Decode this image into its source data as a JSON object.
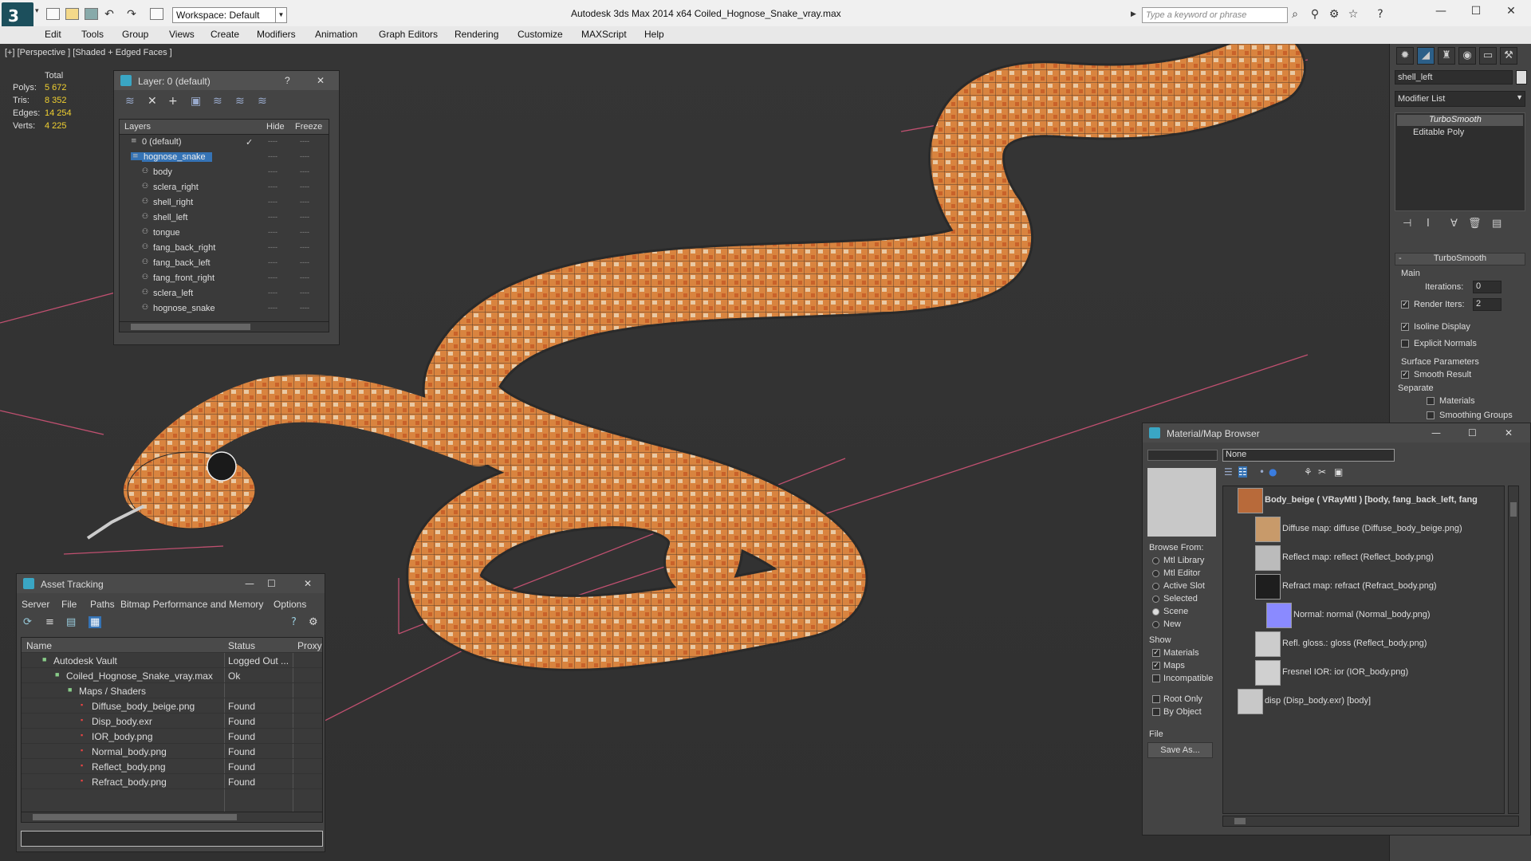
{
  "app": {
    "window_title": "Autodesk 3ds Max  2014 x64      Coiled_Hognose_Snake_vray.max",
    "logo_text": "3",
    "workspace": "Workspace: Default",
    "search_placeholder": "Type a keyword or phrase"
  },
  "menu": [
    "Edit",
    "Tools",
    "Group",
    "Views",
    "Create",
    "Modifiers",
    "Animation",
    "Graph Editors",
    "Rendering",
    "Customize",
    "MAXScript",
    "Help"
  ],
  "viewport": {
    "label": "[+] [Perspective ] [Shaded + Edged Faces ]",
    "stats_title": "Total",
    "stats": [
      {
        "label": "Polys:",
        "value": "5 672"
      },
      {
        "label": "Tris:",
        "value": "8 352"
      },
      {
        "label": "Edges:",
        "value": "14 254"
      },
      {
        "label": "Verts:",
        "value": "4 225"
      }
    ]
  },
  "layer_panel": {
    "title": "Layer: 0 (default)",
    "help": "?",
    "close": "✕",
    "col_layers": "Layers",
    "col_hide": "Hide",
    "col_freeze": "Freeze",
    "rows": [
      {
        "name": "0 (default)",
        "level": 1,
        "selected": false,
        "check": "✓"
      },
      {
        "name": "hognose_snake",
        "level": 1,
        "selected": true,
        "check": ""
      },
      {
        "name": "body",
        "level": 2,
        "selected": false,
        "check": ""
      },
      {
        "name": "sclera_right",
        "level": 2,
        "selected": false,
        "check": ""
      },
      {
        "name": "shell_right",
        "level": 2,
        "selected": false,
        "check": ""
      },
      {
        "name": "shell_left",
        "level": 2,
        "selected": false,
        "check": ""
      },
      {
        "name": "tongue",
        "level": 2,
        "selected": false,
        "check": ""
      },
      {
        "name": "fang_back_right",
        "level": 2,
        "selected": false,
        "check": ""
      },
      {
        "name": "fang_back_left",
        "level": 2,
        "selected": false,
        "check": ""
      },
      {
        "name": "fang_front_right",
        "level": 2,
        "selected": false,
        "check": ""
      },
      {
        "name": "sclera_left",
        "level": 2,
        "selected": false,
        "check": ""
      },
      {
        "name": "hognose_snake",
        "level": 2,
        "selected": false,
        "check": ""
      }
    ]
  },
  "asset_panel": {
    "title": "Asset Tracking",
    "menu": [
      "Server",
      "File",
      "Paths",
      "Bitmap Performance and Memory",
      "Options"
    ],
    "col_name": "Name",
    "col_status": "Status",
    "col_proxy": "Proxy",
    "rows": [
      {
        "name": "Autodesk Vault",
        "status": "Logged Out ...",
        "indent": 1
      },
      {
        "name": "Coiled_Hognose_Snake_vray.max",
        "status": "Ok",
        "indent": 2
      },
      {
        "name": "Maps / Shaders",
        "status": "",
        "indent": 3
      },
      {
        "name": "Diffuse_body_beige.png",
        "status": "Found",
        "indent": 4
      },
      {
        "name": "Disp_body.exr",
        "status": "Found",
        "indent": 4
      },
      {
        "name": "IOR_body.png",
        "status": "Found",
        "indent": 4
      },
      {
        "name": "Normal_body.png",
        "status": "Found",
        "indent": 4
      },
      {
        "name": "Reflect_body.png",
        "status": "Found",
        "indent": 4
      },
      {
        "name": "Refract_body.png",
        "status": "Found",
        "indent": 4
      }
    ]
  },
  "command_panel": {
    "object_name": "shell_left",
    "modifier_list": "Modifier List",
    "stack": [
      "TurboSmooth",
      "Editable Poly"
    ],
    "rollout_title": "TurboSmooth",
    "main_label": "Main",
    "iterations_label": "Iterations:",
    "iterations_value": "0",
    "render_iters_label": "Render Iters:",
    "render_iters_value": "2",
    "isoline": "Isoline Display",
    "explicit_normals": "Explicit Normals",
    "surface_params": "Surface Parameters",
    "smooth_result": "Smooth Result",
    "separate": "Separate",
    "materials": "Materials",
    "smoothing_groups": "Smoothing Groups"
  },
  "material_browser": {
    "title": "Material/Map Browser",
    "search_value": "None",
    "browse_from_label": "Browse From:",
    "browse_from": [
      "Mtl Library",
      "Mtl Editor",
      "Active Slot",
      "Selected",
      "Scene",
      "New"
    ],
    "browse_selected": "Scene",
    "show_label": "Show",
    "show": [
      {
        "label": "Materials",
        "checked": true
      },
      {
        "label": "Maps",
        "checked": true
      },
      {
        "label": "Incompatible",
        "checked": false
      }
    ],
    "root_only": "Root Only",
    "by_object": "By Object",
    "file_label": "File",
    "save_as": "Save As...",
    "items": [
      {
        "text": "Body_beige  ( VRayMtl )  [body, fang_back_left, fang",
        "bold": true
      },
      {
        "text": "Diffuse map: diffuse (Diffuse_body_beige.png)",
        "bold": false
      },
      {
        "text": "Reflect map: reflect (Reflect_body.png)",
        "bold": false
      },
      {
        "text": "Refract map: refract (Refract_body.png)",
        "bold": false
      },
      {
        "text": "Normal: normal (Normal_body.png)",
        "bold": false
      },
      {
        "text": "Refl. gloss.: gloss (Reflect_body.png)",
        "bold": false
      },
      {
        "text": "Fresnel IOR: ior (IOR_body.png)",
        "bold": false
      },
      {
        "text": "disp (Disp_body.exr)  [body]",
        "bold": false
      }
    ]
  }
}
